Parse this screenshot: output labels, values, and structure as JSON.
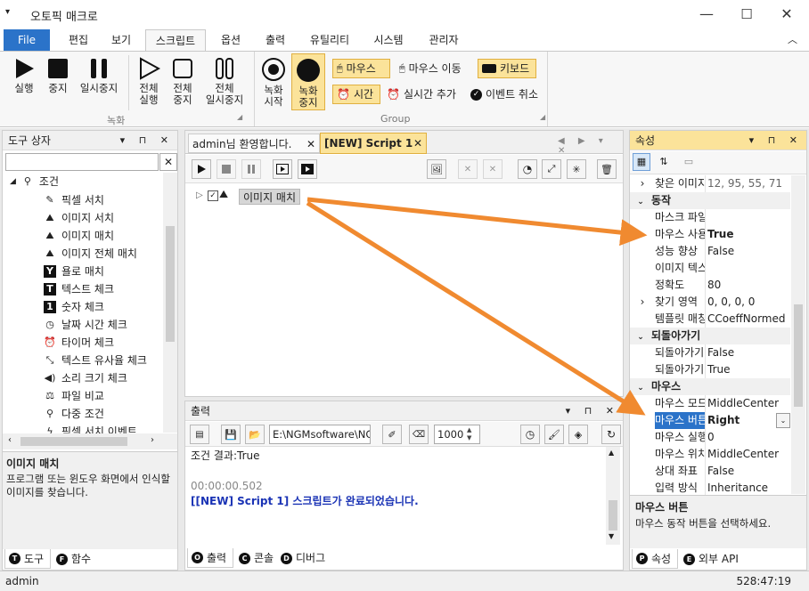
{
  "window": {
    "title": "오토픽 매크로",
    "minimize": "—",
    "maximize": "☐",
    "close": "✕"
  },
  "menu": {
    "file": "File",
    "items": [
      "편집",
      "보기",
      "스크립트",
      "옵션",
      "출력",
      "유틸리티",
      "시스템",
      "관리자"
    ],
    "collapse": "︿"
  },
  "ribbon": {
    "run": "실행",
    "stop": "중지",
    "pause": "일시중지",
    "run_all": [
      "전체",
      "실행"
    ],
    "stop_all": [
      "전체",
      "중지"
    ],
    "pause_all": [
      "전체",
      "일시중지"
    ],
    "record_start": [
      "녹화",
      "시작"
    ],
    "record_stop": [
      "녹화",
      "중지"
    ],
    "group_record": "녹화",
    "mouse": "마우스",
    "mouse_move": "마우스 이동",
    "keyboard": "키보드",
    "time": "시간",
    "realtime_add": "실시간 추가",
    "event_cancel": "이벤트 취소",
    "group_group": "Group"
  },
  "toolbox": {
    "title": "도구 상자",
    "search_value": "",
    "category": "조건",
    "items": [
      "픽셀 서치",
      "이미지 서치",
      "이미지 매치",
      "이미지 전체 매치",
      "욜로 매치",
      "텍스트 체크",
      "숫자 체크",
      "날짜 시간 체크",
      "타이머 체크",
      "텍스트 유사율 체크",
      "소리 크기 체크",
      "파일 비교",
      "다중 조건",
      "픽셀 서치 이벤트"
    ],
    "desc_title": "이미지 매치",
    "desc_text": "프로그램 또는 윈도우 화면에서 인식할 이미지를 찾습니다.",
    "tab_tools": "도구",
    "tab_functions": "함수"
  },
  "editor": {
    "tabs": [
      "admin님 환영합니다.",
      "[NEW] Script 1"
    ],
    "node_label": "이미지 매치"
  },
  "output": {
    "title": "출력",
    "path": "E:\\NGMsoftware\\NG",
    "count": "1000",
    "lines": [
      "조건 결과:True",
      "",
      "00:00:00.502",
      "[[NEW] Script 1] 스크립트가 완료되었습니다."
    ],
    "tab_output": "출력",
    "tab_console": "콘솔",
    "tab_debug": "디버그"
  },
  "properties": {
    "title": "속성",
    "rows": [
      {
        "kind": "prop",
        "exp": "›",
        "name": "찾은 이미지",
        "value": "12, 95, 55, 71",
        "gray": true
      },
      {
        "kind": "cat",
        "name": "동작"
      },
      {
        "kind": "prop",
        "name": "마스크 파일",
        "value": ""
      },
      {
        "kind": "prop",
        "name": "마우스 사용",
        "value": "True",
        "bold": true
      },
      {
        "kind": "prop",
        "name": "성능 향상",
        "value": "False"
      },
      {
        "kind": "prop",
        "name": "이미지 텍스트",
        "value": ""
      },
      {
        "kind": "prop",
        "name": "정확도",
        "value": "80"
      },
      {
        "kind": "prop",
        "exp": "›",
        "name": "찾기 영역",
        "value": "0, 0, 0, 0"
      },
      {
        "kind": "prop",
        "name": "템플릿 매칭",
        "value": "CCoeffNormed"
      },
      {
        "kind": "cat",
        "name": "되돌아가기"
      },
      {
        "kind": "prop",
        "name": "되돌아가기",
        "value": "False"
      },
      {
        "kind": "prop",
        "name": "되돌아가기",
        "value": "True"
      },
      {
        "kind": "cat",
        "name": "마우스"
      },
      {
        "kind": "prop",
        "name": "마우스 모드",
        "value": "MiddleCenter"
      },
      {
        "kind": "prop",
        "name": "마우스 버튼",
        "value": "Right",
        "bold": true,
        "selected": true
      },
      {
        "kind": "prop",
        "name": "마우스 실행",
        "value": "0"
      },
      {
        "kind": "prop",
        "name": "마우스 위치",
        "value": "MiddleCenter"
      },
      {
        "kind": "prop",
        "name": "상대 좌표",
        "value": "False"
      },
      {
        "kind": "prop",
        "name": "입력 방식",
        "value": "Inheritance"
      }
    ],
    "desc_title": "마우스 버튼",
    "desc_text": "마우스 동작 버튼을 선택하세요.",
    "tab_properties": "속성",
    "tab_external": "외부 API"
  },
  "status": {
    "user": "admin",
    "time": "528:47:19"
  },
  "colors": {
    "accent": "#2b73c9",
    "highlight": "#fbe39a",
    "arrow": "#f08a30",
    "output_blue": "#1a33b5"
  }
}
